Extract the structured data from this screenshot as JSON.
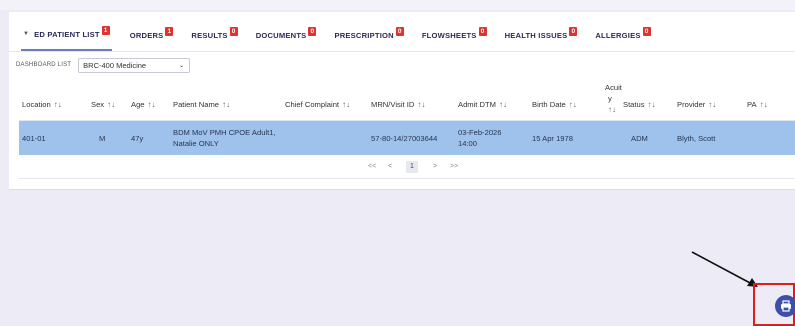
{
  "tabs": [
    {
      "label": "ED PATIENT LIST",
      "badge": "1"
    },
    {
      "label": "ORDERS",
      "badge": "1"
    },
    {
      "label": "RESULTS",
      "badge": "0"
    },
    {
      "label": "DOCUMENTS",
      "badge": "0"
    },
    {
      "label": "PRESCRIPTION",
      "badge": "0"
    },
    {
      "label": "FLOWSHEETS",
      "badge": "0"
    },
    {
      "label": "HEALTH ISSUES",
      "badge": "0"
    },
    {
      "label": "ALLERGIES",
      "badge": "0"
    }
  ],
  "dashboard": {
    "label": "DASHBOARD LIST",
    "selected": "BRC-400 Medicine"
  },
  "sort_glyph": "↑↓",
  "columns": {
    "location": "Location",
    "sex": "Sex",
    "age": "Age",
    "patient_name": "Patient Name",
    "chief_complaint": "Chief Complaint",
    "mrn": "MRN/Visit ID",
    "admit": "Admit DTM",
    "birth": "Birth Date",
    "acuity_1": "Acuit",
    "acuity_2": "y",
    "status": "Status",
    "provider": "Provider",
    "pa": "PA"
  },
  "rows": [
    {
      "location": "401-01",
      "sex": "M",
      "age": "47y",
      "name_1": "BDM MoV PMH CPOE Adult1,",
      "name_2": "Natalie ONLY",
      "chief_complaint": "",
      "mrn": "57-80-14/27003644",
      "admit_1": "03-Feb-2026",
      "admit_2": "14:00",
      "birth": "15 Apr 1978",
      "acuity": "",
      "status": "ADM",
      "provider": "Blyth, Scott",
      "pa": ""
    }
  ],
  "pager": {
    "first": "<<",
    "prev": "<",
    "current": "1",
    "next": ">",
    "last": ">>"
  },
  "colors": {
    "accent": "#3d4fa8",
    "badge": "#e0322f",
    "row_selected": "#9ec2ec",
    "highlight": "#e01c1c"
  },
  "icons": {
    "print": "printer-icon",
    "cursor": "cursor-icon",
    "dropdown": "chevron-down-icon"
  }
}
